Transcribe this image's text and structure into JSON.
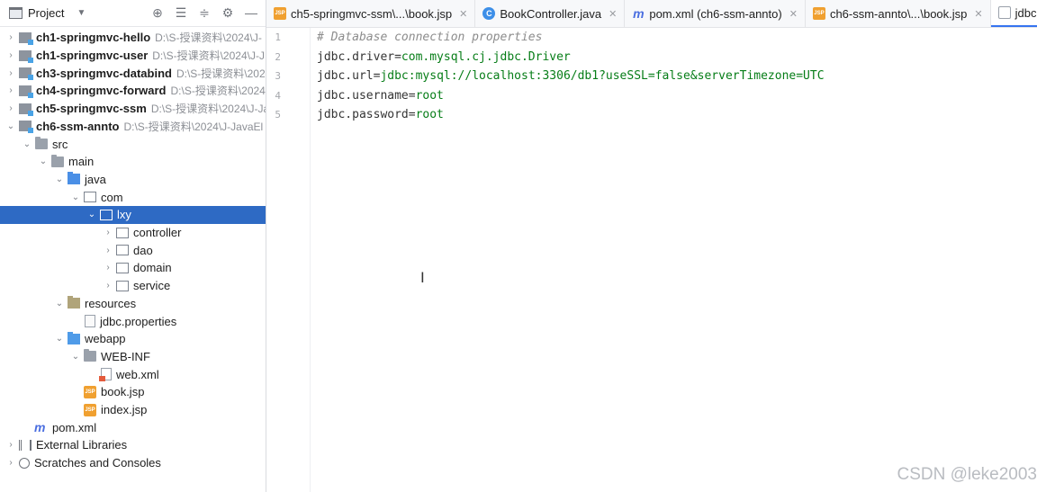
{
  "sidebar": {
    "title": "Project",
    "tools": [
      "⊕",
      "☰",
      "≑",
      "⚙",
      "—"
    ],
    "tree": [
      {
        "label": "ch1-springmvc-hello",
        "path": "D:\\S-授课资料\\2024\\J-",
        "bold": true,
        "chev": "›",
        "icon": "module",
        "depth": 0
      },
      {
        "label": "ch1-springmvc-user",
        "path": "D:\\S-授课资料\\2024\\J-J",
        "bold": true,
        "chev": "›",
        "icon": "module",
        "depth": 0
      },
      {
        "label": "ch3-springmvc-databind",
        "path": "D:\\S-授课资料\\202",
        "bold": true,
        "chev": "›",
        "icon": "module",
        "depth": 0
      },
      {
        "label": "ch4-springmvc-forward",
        "path": "D:\\S-授课资料\\2024",
        "bold": true,
        "chev": "›",
        "icon": "module",
        "depth": 0
      },
      {
        "label": "ch5-springmvc-ssm",
        "path": "D:\\S-授课资料\\2024\\J-Ja",
        "bold": true,
        "chev": "›",
        "icon": "module",
        "depth": 0
      },
      {
        "label": "ch6-ssm-annto",
        "path": "D:\\S-授课资料\\2024\\J-JavaEl",
        "bold": true,
        "chev": "⌄",
        "icon": "module",
        "depth": 0
      },
      {
        "label": "src",
        "path": "",
        "bold": false,
        "chev": "⌄",
        "icon": "folder",
        "depth": 1
      },
      {
        "label": "main",
        "path": "",
        "bold": false,
        "chev": "⌄",
        "icon": "folder",
        "depth": 2
      },
      {
        "label": "java",
        "path": "",
        "bold": false,
        "chev": "⌄",
        "icon": "src",
        "depth": 3
      },
      {
        "label": "com",
        "path": "",
        "bold": false,
        "chev": "⌄",
        "icon": "pkg",
        "depth": 4
      },
      {
        "label": "lxy",
        "path": "",
        "bold": false,
        "chev": "⌄",
        "icon": "pkg",
        "depth": 5,
        "selected": true
      },
      {
        "label": "controller",
        "path": "",
        "bold": false,
        "chev": "›",
        "icon": "pkg",
        "depth": 6
      },
      {
        "label": "dao",
        "path": "",
        "bold": false,
        "chev": "›",
        "icon": "pkg",
        "depth": 6
      },
      {
        "label": "domain",
        "path": "",
        "bold": false,
        "chev": "›",
        "icon": "pkg",
        "depth": 6
      },
      {
        "label": "service",
        "path": "",
        "bold": false,
        "chev": "›",
        "icon": "pkg",
        "depth": 6
      },
      {
        "label": "resources",
        "path": "",
        "bold": false,
        "chev": "⌄",
        "icon": "res",
        "depth": 3
      },
      {
        "label": "jdbc.properties",
        "path": "",
        "bold": false,
        "chev": "",
        "icon": "file",
        "depth": 4
      },
      {
        "label": "webapp",
        "path": "",
        "bold": false,
        "chev": "⌄",
        "icon": "web",
        "depth": 3
      },
      {
        "label": "WEB-INF",
        "path": "",
        "bold": false,
        "chev": "⌄",
        "icon": "folder",
        "depth": 4
      },
      {
        "label": "web.xml",
        "path": "",
        "bold": false,
        "chev": "",
        "icon": "xml",
        "depth": 5
      },
      {
        "label": "book.jsp",
        "path": "",
        "bold": false,
        "chev": "",
        "icon": "jsp",
        "depth": 4
      },
      {
        "label": "index.jsp",
        "path": "",
        "bold": false,
        "chev": "",
        "icon": "jsp",
        "depth": 4
      },
      {
        "label": "pom.xml",
        "path": "",
        "bold": false,
        "chev": "",
        "icon": "maven",
        "depth": 1
      },
      {
        "label": "External Libraries",
        "path": "",
        "bold": false,
        "chev": "›",
        "icon": "lib",
        "depth": 0
      },
      {
        "label": "Scratches and Consoles",
        "path": "",
        "bold": false,
        "chev": "›",
        "icon": "scratch",
        "depth": 0
      }
    ]
  },
  "tabs": [
    {
      "label": "ch5-springmvc-ssm\\...\\book.jsp",
      "icon": "jsp",
      "closable": true,
      "active": false
    },
    {
      "label": "BookController.java",
      "icon": "java",
      "closable": true,
      "active": false
    },
    {
      "label": "pom.xml (ch6-ssm-annto)",
      "icon": "maven",
      "closable": true,
      "active": false
    },
    {
      "label": "ch6-ssm-annto\\...\\book.jsp",
      "icon": "jsp",
      "closable": true,
      "active": false
    },
    {
      "label": "jdbc.pro",
      "icon": "props",
      "closable": false,
      "active": true
    }
  ],
  "editor": {
    "lines": [
      {
        "num": "1",
        "comment": "# Database connection properties"
      },
      {
        "num": "2",
        "key": "jdbc.driver",
        "value": "com.mysql.cj.jdbc.Driver"
      },
      {
        "num": "3",
        "key": "jdbc.url",
        "value": "jdbc:mysql://localhost:3306/db1?useSSL=false&serverTimezone=UTC"
      },
      {
        "num": "4",
        "key": "jdbc.username",
        "value": "root"
      },
      {
        "num": "5",
        "key": "jdbc.password",
        "value": "root"
      }
    ],
    "cursor_glyph": "I"
  },
  "watermark": "CSDN @leke2003",
  "colors": {
    "selection": "#2e6ac4",
    "value_green": "#067d17",
    "comment_gray": "#8c8c8c",
    "active_tab_underline": "#3574f0"
  }
}
